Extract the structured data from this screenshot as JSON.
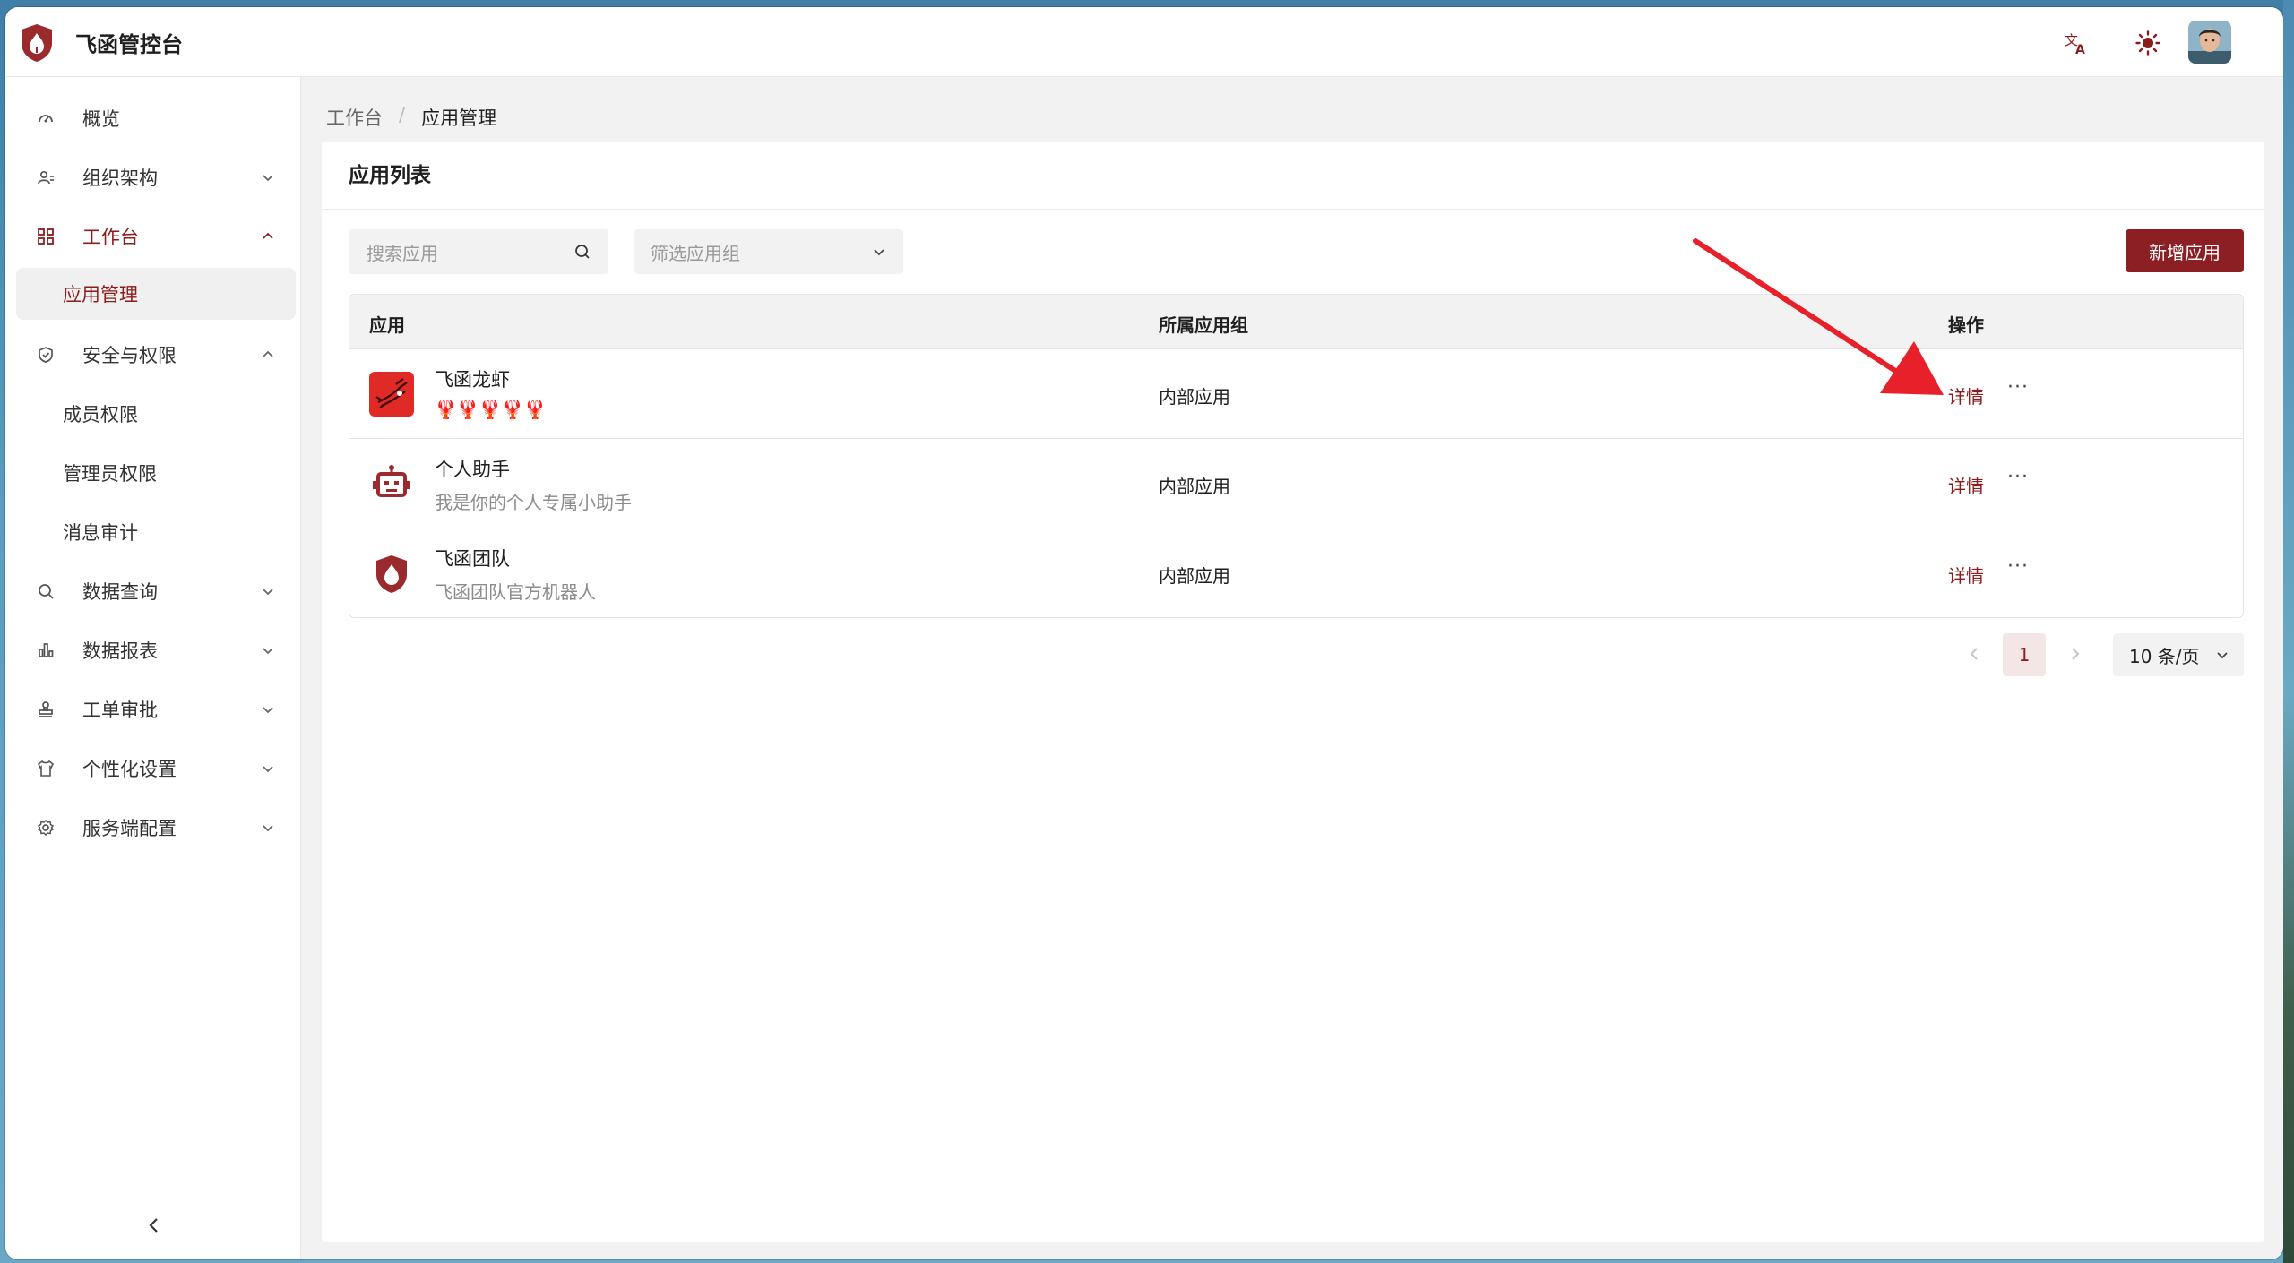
{
  "header": {
    "title": "飞函管控台",
    "translate_icon": "translate-icon",
    "theme_icon": "sun-icon",
    "avatar": "user-avatar"
  },
  "sidebar": {
    "items": [
      {
        "label": "概览",
        "icon": "dashboard-icon"
      },
      {
        "label": "组织架构",
        "icon": "org-icon"
      },
      {
        "label": "工作台",
        "icon": "grid-icon"
      },
      {
        "label": "应用管理"
      },
      {
        "label": "安全与权限",
        "icon": "shield-icon"
      },
      {
        "label": "成员权限"
      },
      {
        "label": "管理员权限"
      },
      {
        "label": "消息审计"
      },
      {
        "label": "数据查询",
        "icon": "search-icon"
      },
      {
        "label": "数据报表",
        "icon": "bar-chart-icon"
      },
      {
        "label": "工单审批",
        "icon": "stamp-icon"
      },
      {
        "label": "个性化设置",
        "icon": "shirt-icon"
      },
      {
        "label": "服务端配置",
        "icon": "gear-icon"
      }
    ]
  },
  "breadcrumb": {
    "root": "工作台",
    "separator": "/",
    "current": "应用管理"
  },
  "panel": {
    "title": "应用列表",
    "search_placeholder": "搜索应用",
    "filter_placeholder": "筛选应用组",
    "add_button": "新增应用"
  },
  "table": {
    "columns": [
      "应用",
      "所属应用组",
      "操作"
    ],
    "rows": [
      {
        "name": "飞函龙虾",
        "desc": "🦞🦞🦞🦞🦞",
        "group": "内部应用",
        "action": "详情",
        "more": "···"
      },
      {
        "name": "个人助手",
        "desc": "我是你的个人专属小助手",
        "group": "内部应用",
        "action": "详情",
        "more": "···"
      },
      {
        "name": "飞函团队",
        "desc": "飞函团队官方机器人",
        "group": "内部应用",
        "action": "详情",
        "more": "···"
      }
    ]
  },
  "pagination": {
    "current_page": "1",
    "page_size": "10 条/页"
  },
  "colors": {
    "accent": "#8b1f24",
    "annotation_arrow": "#e8202a"
  }
}
